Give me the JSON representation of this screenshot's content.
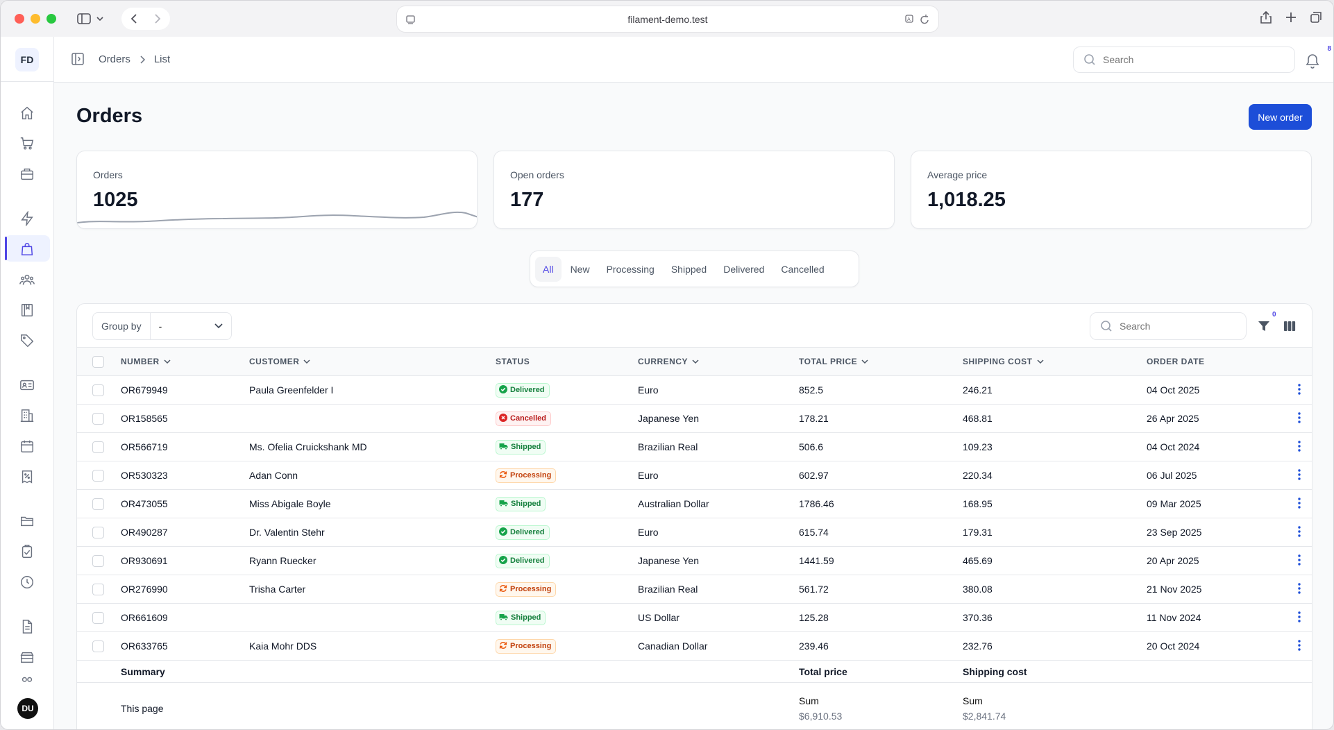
{
  "browser": {
    "url": "filament-demo.test"
  },
  "sidebar": {
    "brand_initials": "FD",
    "user_initials": "DU"
  },
  "breadcrumb": {
    "items": [
      "Orders",
      "List"
    ]
  },
  "topbar": {
    "search_placeholder": "Search",
    "notification_count": "8"
  },
  "page": {
    "title": "Orders",
    "new_button": "New order"
  },
  "stats": [
    {
      "label": "Orders",
      "value": "1025"
    },
    {
      "label": "Open orders",
      "value": "177"
    },
    {
      "label": "Average price",
      "value": "1,018.25"
    }
  ],
  "tabs": [
    "All",
    "New",
    "Processing",
    "Shipped",
    "Delivered",
    "Cancelled"
  ],
  "toolbar": {
    "group_by_label": "Group by",
    "group_by_value": "-",
    "search_placeholder": "Search",
    "filter_count": "0"
  },
  "table": {
    "columns": [
      "NUMBER",
      "CUSTOMER",
      "STATUS",
      "CURRENCY",
      "TOTAL PRICE",
      "SHIPPING COST",
      "ORDER DATE"
    ],
    "rows": [
      {
        "number": "OR679949",
        "customer": "Paula Greenfelder I",
        "status": "Delivered",
        "currency": "Euro",
        "total": "852.5",
        "shipping": "246.21",
        "date": "04 Oct 2025"
      },
      {
        "number": "OR158565",
        "customer": "",
        "status": "Cancelled",
        "currency": "Japanese Yen",
        "total": "178.21",
        "shipping": "468.81",
        "date": "26 Apr 2025"
      },
      {
        "number": "OR566719",
        "customer": "Ms. Ofelia Cruickshank MD",
        "status": "Shipped",
        "currency": "Brazilian Real",
        "total": "506.6",
        "shipping": "109.23",
        "date": "04 Oct 2024"
      },
      {
        "number": "OR530323",
        "customer": "Adan Conn",
        "status": "Processing",
        "currency": "Euro",
        "total": "602.97",
        "shipping": "220.34",
        "date": "06 Jul 2025"
      },
      {
        "number": "OR473055",
        "customer": "Miss Abigale Boyle",
        "status": "Shipped",
        "currency": "Australian Dollar",
        "total": "1786.46",
        "shipping": "168.95",
        "date": "09 Mar 2025"
      },
      {
        "number": "OR490287",
        "customer": "Dr. Valentin Stehr",
        "status": "Delivered",
        "currency": "Euro",
        "total": "615.74",
        "shipping": "179.31",
        "date": "23 Sep 2025"
      },
      {
        "number": "OR930691",
        "customer": "Ryann Ruecker",
        "status": "Delivered",
        "currency": "Japanese Yen",
        "total": "1441.59",
        "shipping": "465.69",
        "date": "20 Apr 2025"
      },
      {
        "number": "OR276990",
        "customer": "Trisha Carter",
        "status": "Processing",
        "currency": "Brazilian Real",
        "total": "561.72",
        "shipping": "380.08",
        "date": "21 Nov 2025"
      },
      {
        "number": "OR661609",
        "customer": "",
        "status": "Shipped",
        "currency": "US Dollar",
        "total": "125.28",
        "shipping": "370.36",
        "date": "11 Nov 2024"
      },
      {
        "number": "OR633765",
        "customer": "Kaia Mohr DDS",
        "status": "Processing",
        "currency": "Canadian Dollar",
        "total": "239.46",
        "shipping": "232.76",
        "date": "20 Oct 2024"
      }
    ],
    "summary": {
      "label": "Summary",
      "total_label": "Total price",
      "shipping_label": "Shipping cost",
      "page_label": "This page",
      "sum_label": "Sum",
      "total_sum": "$6,910.53",
      "shipping_sum": "$2,841.74"
    }
  },
  "colors": {
    "accent": "#4f46e5",
    "primary_button": "#1d4ed8",
    "success": "#15803d",
    "danger": "#b91c1c",
    "warning": "#c2410c"
  },
  "icons": [
    "sidebar-toggle-icon",
    "search-icon",
    "bell-icon",
    "home-icon",
    "cart-icon",
    "briefcase-icon",
    "bolt-icon",
    "shopping-bag-icon",
    "users-icon",
    "book-icon",
    "tag-icon",
    "id-card-icon",
    "building-icon",
    "calendar-icon",
    "receipt-percent-icon",
    "folder-icon",
    "clipboard-check-icon",
    "clock-icon",
    "document-icon",
    "archive-icon",
    "filter-icon",
    "columns-icon",
    "kebab-icon"
  ]
}
